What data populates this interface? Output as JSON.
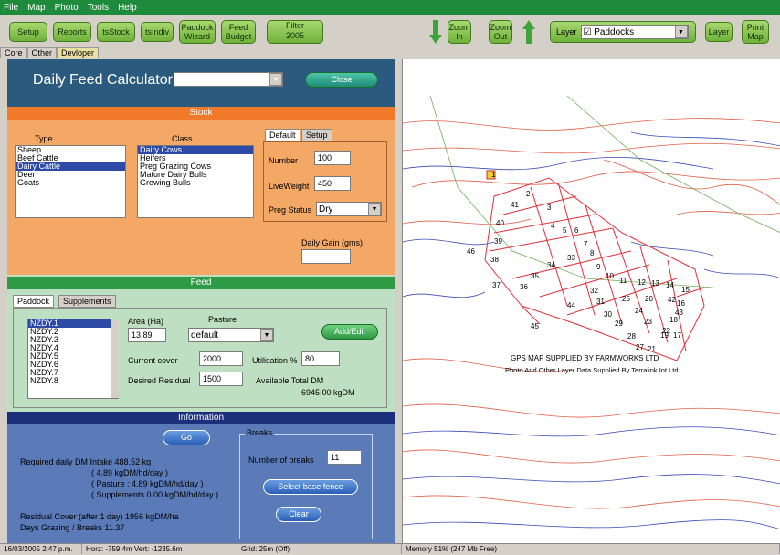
{
  "menu": [
    "File",
    "Map",
    "Photo",
    "Tools",
    "Help"
  ],
  "toolbar": {
    "buttons": [
      "Setup",
      "Reports",
      "tsStock",
      "tsIndiv",
      "Paddock Wizard",
      "Feed Budget"
    ],
    "filter_label": "Filter",
    "filter_value": "2005",
    "zoom_in": "Zoom In",
    "zoom_out": "Zoom Out",
    "layer_label": "Layer",
    "layer_value": "Paddocks",
    "layer_button": "Layer",
    "print_map": "Print Map"
  },
  "tabs": [
    "Core",
    "Other",
    "Devloper"
  ],
  "calculator": {
    "title": "Daily Feed Calculator",
    "mode": "Single paddock",
    "close": "Close"
  },
  "stock": {
    "band": "Stock",
    "type_label": "Type",
    "class_label": "Class",
    "types": [
      "Sheep",
      "Beef Cattle",
      "Dairy Cattle",
      "Deer",
      "Goats"
    ],
    "types_selected": 2,
    "classes": [
      "Dairy Cows",
      "Heifers",
      "Preg Grazing Cows",
      "Mature Dairy Bulls",
      "Growing Bulls"
    ],
    "classes_selected": 0,
    "tab_default": "Default",
    "tab_setup": "Setup",
    "number_label": "Number",
    "number": "100",
    "liveweight_label": "LiveWeight",
    "liveweight": "450",
    "preg_label": "Preg Status",
    "preg": "Dry",
    "daily_gain_label": "Daily Gain (gms)",
    "daily_gain": ""
  },
  "feed": {
    "band": "Feed",
    "tab_paddock": "Paddock",
    "tab_supplements": "Supplements",
    "paddocks": [
      "NZDY.1",
      "NZDY.2",
      "NZDY.3",
      "NZDY.4",
      "NZDY.5",
      "NZDY.6",
      "NZDY.7",
      "NZDY.8"
    ],
    "paddocks_selected": 0,
    "area_label": "Area (Ha)",
    "area": "13.89",
    "pasture_label": "Pasture",
    "pasture": "default",
    "add_edit": "Add/Edit",
    "cover_label": "Current cover",
    "cover": "2000",
    "util_label": "Utilisation %",
    "util": "80",
    "residual_label": "Desired Residual",
    "residual": "1500",
    "avail_label": "Available Total DM",
    "avail_value": "6945.00 kgDM"
  },
  "info": {
    "band": "Information",
    "go": "Go",
    "intake": "Required daily DM Intake  488.52 kg",
    "intake_ha": "( 4.89 kgDM/hd/day )",
    "pasture_line": "( Pasture : 4.89 kgDM/hd/day )",
    "supp_line": "( Supplements 0.00 kgDM/hd/day )",
    "residual_cover": "Residual Cover (after 1 day)  1956 kgDM/ha",
    "days_grazing": "Days Grazing / Breaks       11.37",
    "breaks_title": "Breaks",
    "breaks_label": "Number of breaks",
    "breaks": "11",
    "select_fence": "Select base fence",
    "clear": "Clear"
  },
  "map": {
    "credit1": "GPS MAP SUPPLIED BY FARMWORKS LTD",
    "credit2": "Photo And Other Layer Data Supplied By Terralink Int Ltd",
    "paddock_numbers": [
      "1",
      "2",
      "3",
      "4",
      "5",
      "6",
      "7",
      "8",
      "9",
      "10",
      "11",
      "12",
      "13",
      "14",
      "15",
      "16",
      "17",
      "18",
      "19",
      "20",
      "21",
      "22",
      "23",
      "24",
      "25",
      "27",
      "28",
      "29",
      "30",
      "31",
      "32",
      "33",
      "34",
      "35",
      "36",
      "37",
      "38",
      "39",
      "40",
      "41",
      "42",
      "43",
      "44",
      "45",
      "46"
    ]
  },
  "status": {
    "datetime": "16/03/2005 2:47 p.m.",
    "coords": "Horz: -759.4m  Vert: -1235.6m",
    "grid": "Grid: 25m (Off)",
    "memory": "Memory 51% (247 Mb Free)"
  },
  "colors": {
    "menu": "#1d8a3c",
    "header": "#2a5a7e",
    "stock": "#f3a865",
    "feed": "#bfdfc3",
    "info": "#5a7ab8",
    "contour_red": "#e0604a",
    "contour_blue": "#3a4ab8"
  }
}
